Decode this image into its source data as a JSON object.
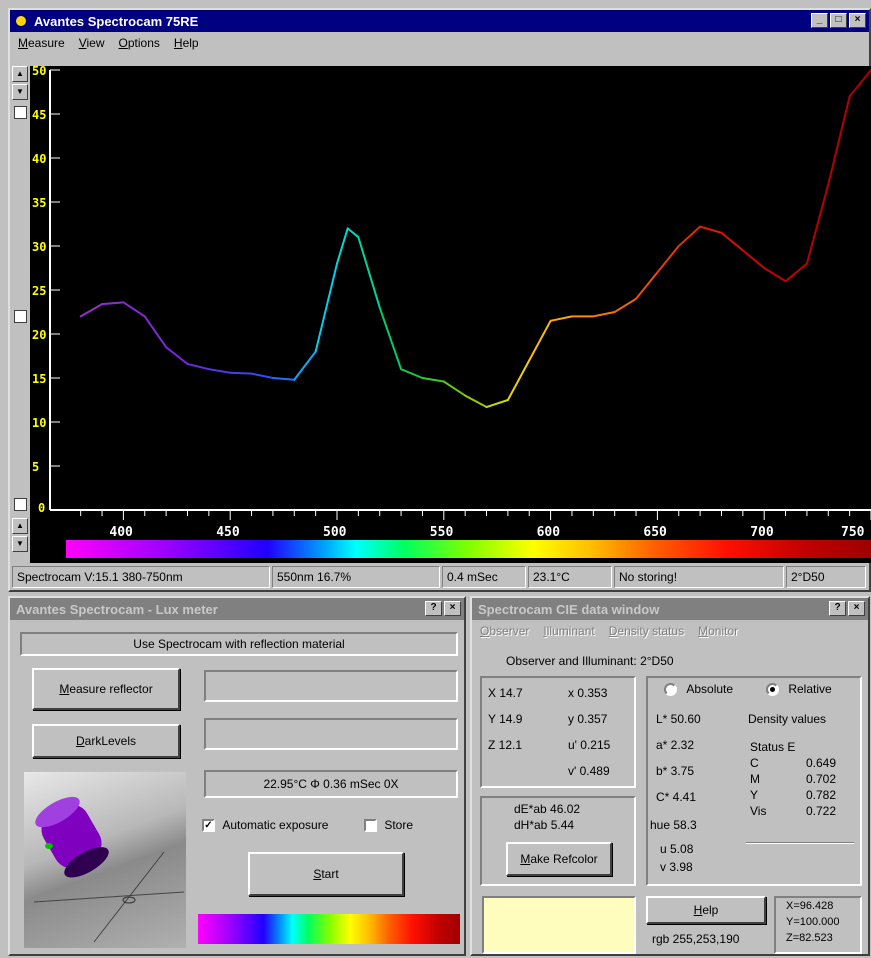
{
  "main_window": {
    "title": "Avantes Spectrocam 75RE",
    "menu": [
      "Measure",
      "View",
      "Options",
      "Help"
    ],
    "title_buttons": [
      "_",
      "□",
      "×"
    ]
  },
  "chart_data": {
    "type": "line",
    "x": [
      380,
      390,
      400,
      410,
      420,
      430,
      440,
      450,
      460,
      470,
      480,
      490,
      500,
      505,
      510,
      520,
      530,
      540,
      550,
      560,
      570,
      580,
      590,
      600,
      610,
      620,
      630,
      640,
      650,
      660,
      670,
      680,
      690,
      700,
      710,
      720,
      730,
      740,
      750
    ],
    "y": [
      22,
      23.4,
      23.6,
      22,
      18.5,
      16.6,
      16,
      15.6,
      15.5,
      15,
      14.8,
      18,
      28,
      32,
      31,
      23,
      16,
      15,
      14.6,
      13,
      11.7,
      12.5,
      17,
      21.5,
      22,
      22,
      22.5,
      24,
      27,
      30,
      32.2,
      31.5,
      29.5,
      27.5,
      26,
      28,
      37,
      47,
      50
    ],
    "xlim": [
      375,
      750
    ],
    "ylim": [
      0,
      50
    ],
    "x_ticks": [
      400,
      450,
      500,
      550,
      600,
      650,
      700,
      750
    ],
    "y_ticks": [
      5,
      10,
      15,
      20,
      25,
      30,
      35,
      40,
      45,
      50
    ],
    "background": "#000000",
    "tick_color_y": "#ffff00",
    "tick_color_x": "#ffffff"
  },
  "status": {
    "version": "Spectrocam V:15.1 380-750nm",
    "cursor": "550nm 16.7%",
    "integration": "0.4 mSec",
    "temp": "23.1°C",
    "storing": "No storing!",
    "observer": "2°D50"
  },
  "lux": {
    "title": "Avantes Spectrocam - Lux meter",
    "title_buttons": [
      "?",
      "×"
    ],
    "info": "Use Spectrocam with reflection material",
    "measure_btn": "Measure reflector",
    "dark_btn": "DarkLevels",
    "field1": "",
    "field2": "",
    "readout": "22.95°C Φ 0.36 mSec 0X",
    "auto_exposure_label": "Automatic exposure",
    "auto_exposure_checked": "✓",
    "store_label": "Store",
    "start_btn": "Start"
  },
  "cie": {
    "title": "Spectrocam CIE data window",
    "title_buttons": [
      "?",
      "×"
    ],
    "menu": [
      "Observer",
      "Illuminant",
      "Density status",
      "Monitor"
    ],
    "observer_line": "Observer and Illuminant: 2°D50",
    "X": "X  14.7",
    "Y": "Y  14.9",
    "Z": "Z  12.1",
    "x": "x  0.353",
    "y": "y  0.357",
    "u": "u'  0.215",
    "v": "v'  0.489",
    "dEab": "dE*ab  46.02",
    "dHab": "dH*ab  5.44",
    "make_ref_btn": "Make Refcolor",
    "absolute_label": "Absolute",
    "relative_label": "Relative",
    "L": "L*   50.60",
    "a": "a*   2.32",
    "b": "b*   3.75",
    "C": "C*   4.41",
    "hue": "hue   58.3",
    "u2": "u     5.08",
    "v2": "v     3.98",
    "density_label": "Density values",
    "status_label": "Status E",
    "density": [
      {
        "k": "C",
        "v": "0.649"
      },
      {
        "k": "M",
        "v": "0.702"
      },
      {
        "k": "Y",
        "v": "0.782"
      },
      {
        "k": "Vis",
        "v": "0.722"
      }
    ],
    "help_btn": "Help",
    "rgb": "rgb 255,253,190",
    "swatch_color": "#fffdbe",
    "XYZn_X": "X=96.428",
    "XYZn_Y": "Y=100.000",
    "XYZn_Z": "Z=82.523"
  }
}
